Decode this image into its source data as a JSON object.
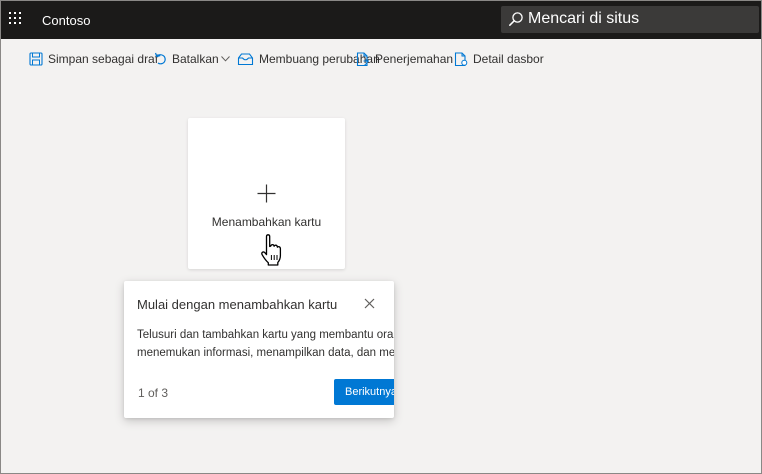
{
  "header": {
    "app_name": "Contoso",
    "search_placeholder": "Mencari di situs",
    "icons": {
      "launcher": "waffle-icon",
      "search": "search-icon"
    }
  },
  "commandbar": {
    "save_draft": "Simpan sebagai draf",
    "undo": "Batalkan",
    "discard": "Membuang perubahan",
    "translate": "Penerjemahan",
    "details": "Detail dasbor"
  },
  "add_card": {
    "label": "Menambahkan kartu"
  },
  "callout": {
    "title": "Mulai dengan menambahkan kartu",
    "body_line1": "Telusuri dan tambahkan kartu yang membantu orang lain",
    "body_line2": "menemukan informasi, menampilkan data, dan menyelesaikan tugas.",
    "pager": "1 of 3",
    "next_label": "Berikutnya"
  },
  "colors": {
    "topbar": "#1b1a19",
    "search_bg": "#3b3a39",
    "canvas": "#f3f2f1",
    "accent": "#0078d4"
  }
}
